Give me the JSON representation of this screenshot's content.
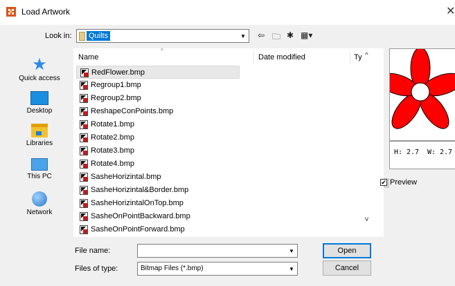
{
  "window": {
    "title": "Load Artwork",
    "close_glyph": "✕"
  },
  "lookin": {
    "label": "Look in:",
    "value": "Quilts",
    "folder_icon": "folder-icon"
  },
  "toolbar": {
    "back_glyph": "⇦",
    "up_glyph": "🗀",
    "newfolder_glyph": "✱",
    "views_glyph": "▦▾"
  },
  "places": [
    {
      "label": "Quick access",
      "icon": "quick-access-icon"
    },
    {
      "label": "Desktop",
      "icon": "desktop-icon"
    },
    {
      "label": "Libraries",
      "icon": "libraries-icon"
    },
    {
      "label": "This PC",
      "icon": "this-pc-icon"
    },
    {
      "label": "Network",
      "icon": "network-icon"
    }
  ],
  "columns": {
    "name": "Name",
    "date": "Date modified",
    "type": "Ty"
  },
  "files": [
    "RedFlower.bmp",
    "Regroup1.bmp",
    "Regroup2.bmp",
    "ReshapeConPoints.bmp",
    "Rotate1.bmp",
    "Rotate2.bmp",
    "Rotate3.bmp",
    "Rotate4.bmp",
    "SasheHorizintal.bmp",
    "SasheHorizintal&Border.bmp",
    "SasheHorizintalOnTop.bmp",
    "SasheOnPointBackward.bmp",
    "SasheOnPointForward.bmp"
  ],
  "preview": {
    "h_label": "H:",
    "h_value": "2.7",
    "w_label": "W:",
    "w_value": "2.7",
    "checkbox_label": "Preview",
    "checkbox_mark": "✔",
    "flower_color": "#ff0000"
  },
  "filename": {
    "label": "File name:",
    "value": ""
  },
  "filetype": {
    "label": "Files of type:",
    "value": "Bitmap Files (*.bmp)"
  },
  "buttons": {
    "open": "Open",
    "cancel": "Cancel"
  },
  "glyphs": {
    "dropdown": "▼",
    "sort_up": "^",
    "scroll_up": "^",
    "scroll_down": "v"
  }
}
